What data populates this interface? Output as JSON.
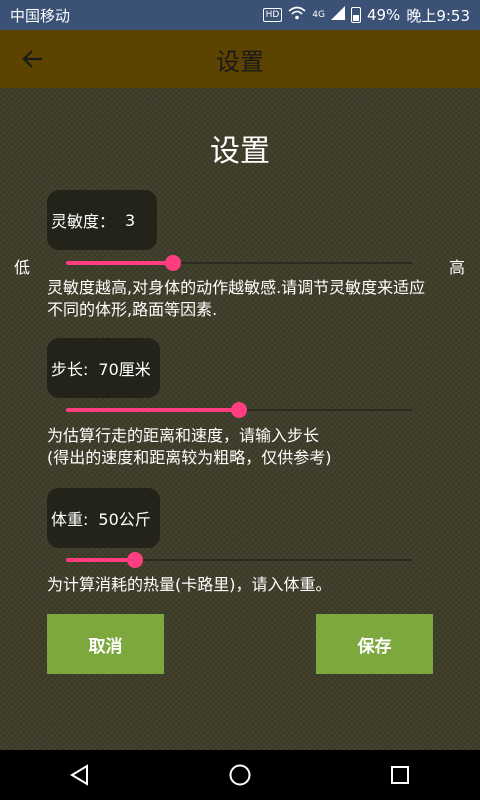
{
  "status_bar": {
    "carrier": "中国移动",
    "hd": "HD",
    "signal_label": "4G",
    "battery": "49%",
    "time": "晚上9:53"
  },
  "app_bar": {
    "title": "设置",
    "back_icon": "arrow-left-icon"
  },
  "page": {
    "title": "设置"
  },
  "sensitivity": {
    "label": "灵敏度：",
    "value": "3",
    "low": "低",
    "high": "高",
    "slider_fraction": 0.31,
    "description": "灵敏度越高,对身体的动作越敏感.请调节灵敏度来适应不同的体形,路面等因素."
  },
  "step": {
    "label": "步长:",
    "value": "70厘米",
    "slider_fraction": 0.5,
    "description_line1": "为估算行走的距离和速度，请输入步长",
    "description_line2": "(得出的速度和距离较为粗略，仅供参考)"
  },
  "weight": {
    "label": "体重:",
    "value": "50公斤",
    "slider_fraction": 0.2,
    "description": "为计算消耗的热量(卡路里)，请入体重。"
  },
  "buttons": {
    "cancel": "取消",
    "save": "保存"
  },
  "colors": {
    "accent": "#ff3d7f",
    "button": "#7da83d",
    "app_bar": "#5d4300",
    "status_bar": "#3b5276"
  },
  "nav": {
    "back_icon": "triangle-back-icon",
    "home_icon": "circle-home-icon",
    "recents_icon": "square-recents-icon"
  }
}
